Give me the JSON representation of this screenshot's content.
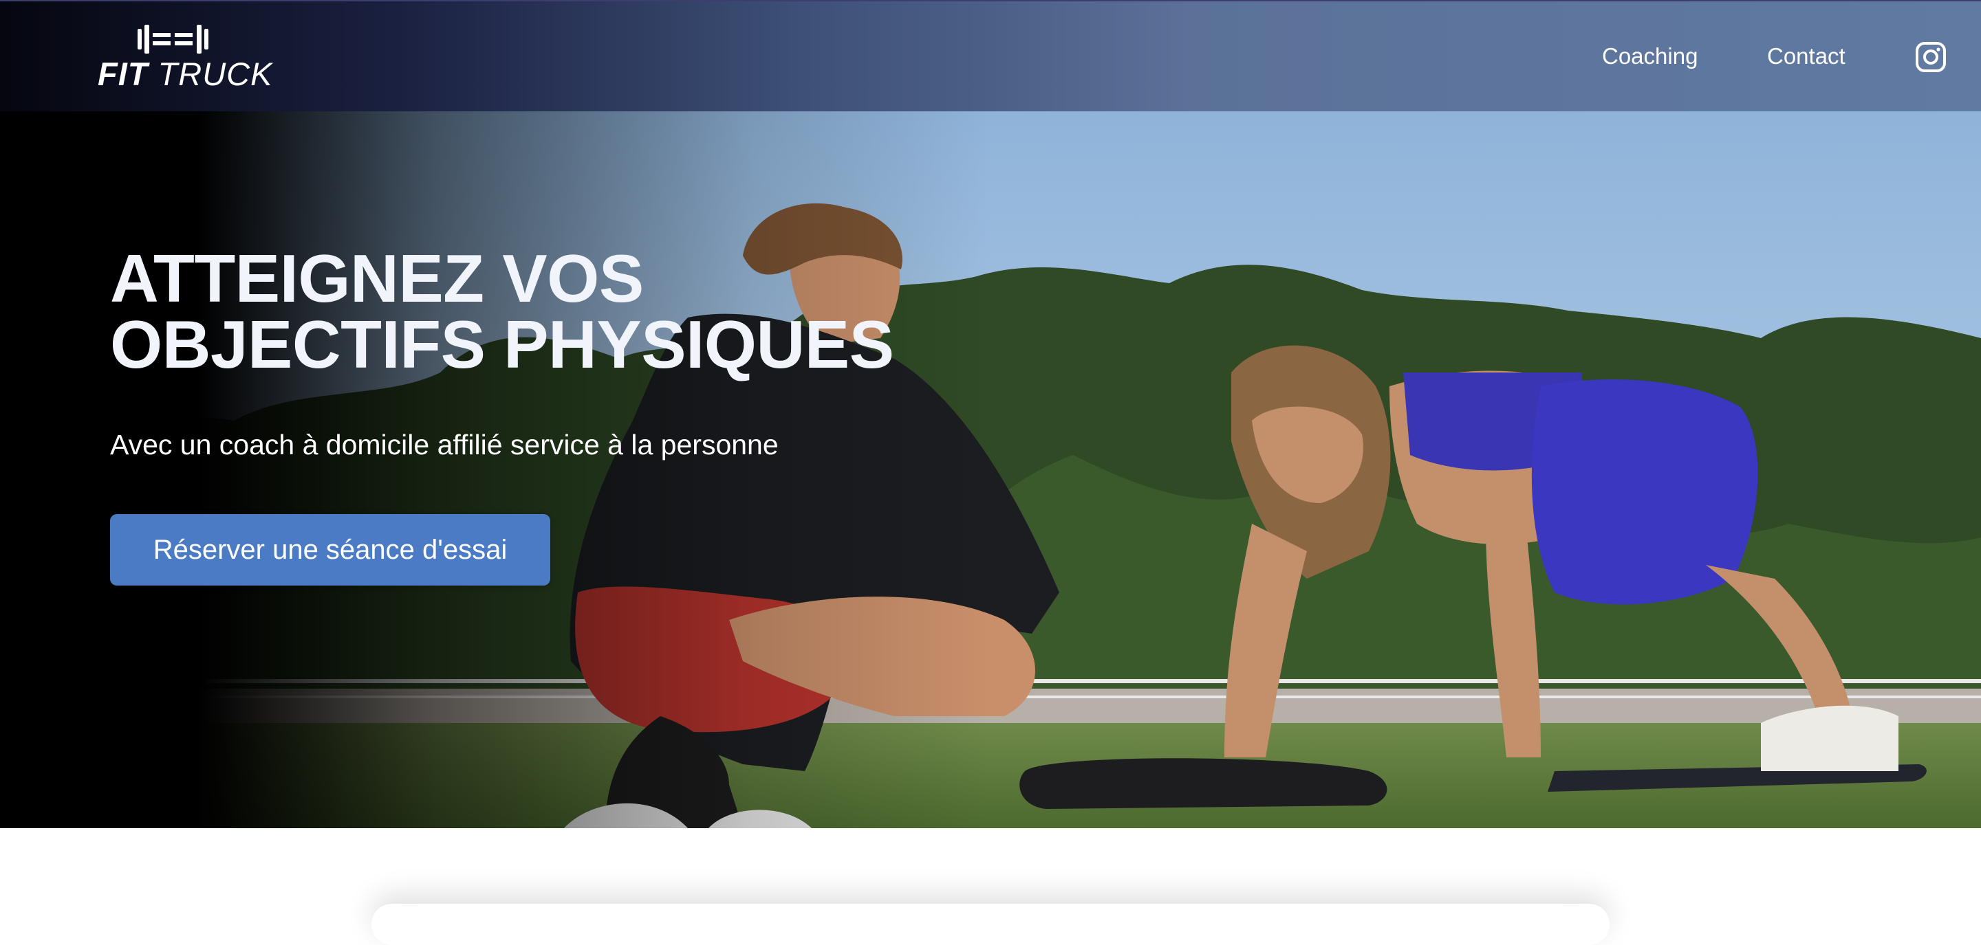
{
  "brand": {
    "name_bold": "FIT",
    "name_light": "TRUCK",
    "logo_icon": "dumbbell-icon"
  },
  "nav": {
    "links": [
      {
        "label": "Coaching"
      },
      {
        "label": "Contact"
      }
    ],
    "social_icon": "instagram-icon"
  },
  "hero": {
    "title_line1": "ATTEIGNEZ VOS",
    "title_line2": "OBJECTIFS PHYSIQUES",
    "subtitle": "Avec un coach à domicile affilié service à la personne",
    "cta_label": "Réserver une séance d'essai"
  },
  "colors": {
    "navbar_start": "#05060f",
    "navbar_end": "#607aa2",
    "cta_background": "#4a7bc4",
    "title_text": "#f1f5fb"
  }
}
